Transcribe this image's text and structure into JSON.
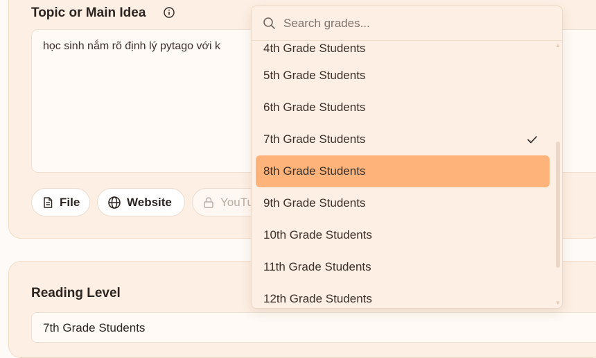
{
  "topic": {
    "title": "Topic or Main Idea",
    "info_icon": "info-circle-icon",
    "text": "học sinh nắm rõ định lý pytago với k"
  },
  "sources": {
    "file_label": "File",
    "website_label": "Website",
    "youtube_label": "YouTube",
    "file_icon": "file-icon",
    "website_icon": "globe-icon",
    "youtube_icon": "lock-icon"
  },
  "reading": {
    "title": "Reading Level",
    "selected": "7th Grade Students"
  },
  "dropdown": {
    "search_placeholder": "Search grades...",
    "options": [
      "4th Grade Students",
      "5th Grade Students",
      "6th Grade Students",
      "7th Grade Students",
      "8th Grade Students",
      "9th Grade Students",
      "10th Grade Students",
      "11th Grade Students",
      "12th Grade Students"
    ],
    "selected_index": 3,
    "highlighted_index": 4
  },
  "colors": {
    "card_bg": "#fdefe3",
    "highlight": "#fdb37a",
    "text": "#2b2420"
  }
}
